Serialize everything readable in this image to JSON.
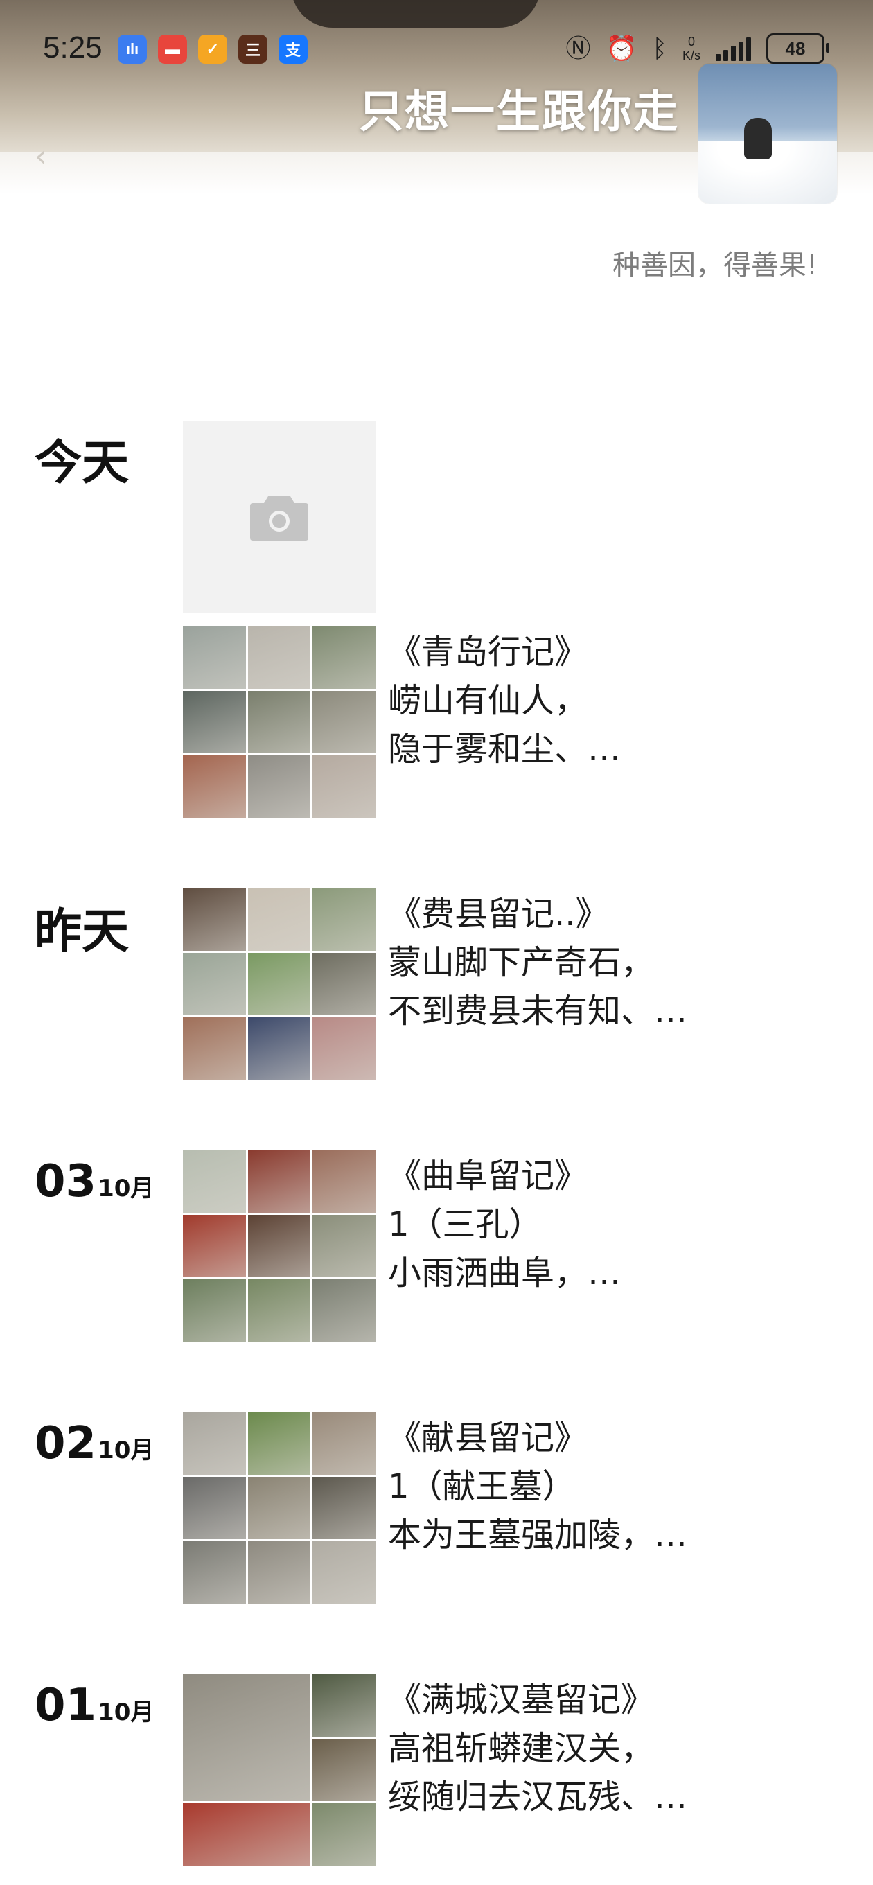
{
  "status_bar": {
    "time": "5:25",
    "apps": [
      {
        "icon": "voice-recorder-icon",
        "color": "#3b7cf0",
        "glyph": "ılı"
      },
      {
        "icon": "red-app-icon",
        "color": "#e8453c",
        "glyph": "▬"
      },
      {
        "icon": "orange-app-icon",
        "color": "#f5a623",
        "glyph": "✓"
      },
      {
        "icon": "game-app-icon",
        "color": "#5a2d1a",
        "glyph": "三"
      },
      {
        "icon": "alipay-icon",
        "color": "#1677ff",
        "glyph": "支"
      }
    ],
    "net_speed_value": "0",
    "net_speed_unit": "K/s",
    "battery": "48"
  },
  "header": {
    "nickname": "只想一生跟你走",
    "signature": "种善因，得善果!"
  },
  "feed": {
    "today_label": "今天",
    "yesterday_label": "昨天",
    "posts": [
      {
        "lines": [
          "《青岛行记》",
          "崂山有仙人，",
          "隐于雾和尘、…"
        ],
        "photos": [
          "#9aa29c",
          "#b9b5ac",
          "#7e8a70",
          "#5d6660",
          "#7a7f6d",
          "#8c8a7c",
          "#a4654f",
          "#8f8d86",
          "#b5aaa0"
        ]
      },
      {
        "lines": [
          "《费县留记..》",
          "蒙山脚下产奇石，",
          "不到费县未有知、…"
        ],
        "photos": [
          "#5f4d40",
          "#c9c1b4",
          "#8b9a7a",
          "#9aa597",
          "#7a9a62",
          "#6e6d60",
          "#a0705a",
          "#3d4a6b",
          "#b88a86"
        ]
      },
      {
        "lines": [
          "《曲阜留记》",
          "1（三孔）",
          "小雨洒曲阜，…"
        ],
        "photos": [
          "#b7bdb0",
          "#8a3a2e",
          "#9a6c5a",
          "#a13a2c",
          "#5c4234",
          "#8a8e7a",
          "#6d7f5e",
          "#778863",
          "#7b7f72"
        ]
      },
      {
        "lines": [
          "《献县留记》",
          "1（献王墓）",
          "本为王墓强加陵，…"
        ],
        "photos": [
          "#a9a69e",
          "#6b8a4c",
          "#998a7a",
          "#6a6a68",
          "#8a8373",
          "#5c584e",
          "#7b7b74",
          "#8e8a80",
          "#b0aca3"
        ]
      },
      {
        "lines": [
          "《满城汉墓留记》",
          "高祖斩蟒建汉关，",
          "绥随归去汉瓦残、…"
        ],
        "photos": [
          "#8f8b80",
          "#4f5a42",
          "#6a5e4a",
          "#a93a2e",
          "#7d8a6c"
        ]
      }
    ],
    "dates": [
      {
        "day": "03",
        "month": "10月"
      },
      {
        "day": "02",
        "month": "10月"
      },
      {
        "day": "01",
        "month": "10月"
      }
    ]
  }
}
